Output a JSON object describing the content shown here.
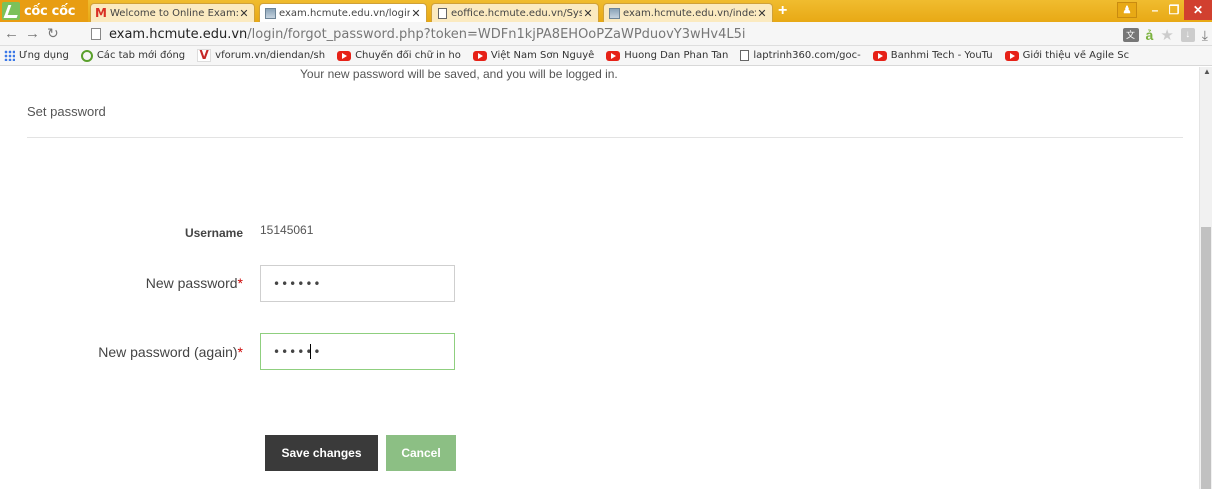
{
  "browser": {
    "brand": "cốc cốc",
    "tabs": [
      {
        "label": "Welcome to Online Exam:",
        "icon": "gmail-icon",
        "active": false
      },
      {
        "label": "exam.hcmute.edu.vn/login",
        "icon": "site-icon",
        "active": true
      },
      {
        "label": "eoffice.hcmute.edu.vn/Syst",
        "icon": "page-icon",
        "active": false
      },
      {
        "label": "exam.hcmute.edu.vn/index",
        "icon": "site-icon",
        "active": false
      }
    ],
    "new_tab": "+",
    "url_host": "exam.hcmute.edu.vn",
    "url_path": "/login/forgot_password.php?token=WDFn1kjPA8EHOoPZaWPduovY3wHv4L5i",
    "bookmarks": [
      {
        "label": "Ứng dụng",
        "icon": "apps-grid-icon"
      },
      {
        "label": "Các tab mới đóng",
        "icon": "recent-tabs-icon"
      },
      {
        "label": "vforum.vn/diendan/sh",
        "icon": "vforum-icon"
      },
      {
        "label": "Chuyển đổi chữ in ho",
        "icon": "youtube-icon"
      },
      {
        "label": "Việt Nam Sơn Nguyễ",
        "icon": "youtube-icon"
      },
      {
        "label": "Huong Dan Phan Tan",
        "icon": "youtube-icon"
      },
      {
        "label": "laptrinh360.com/goc-",
        "icon": "page-icon"
      },
      {
        "label": "Banhmi Tech - YouTu",
        "icon": "youtube-icon"
      },
      {
        "label": "Giới thiệu về Agile Sc",
        "icon": "youtube-icon"
      }
    ]
  },
  "page": {
    "info_text": "Your new password will be saved, and you will be logged in.",
    "section_title": "Set password",
    "username_label": "Username",
    "username_value": "15145061",
    "new_password_label": "New password",
    "new_password_value": "••••••",
    "new_password_again_label": "New password (again)",
    "new_password_again_value": "••••••",
    "required_mark": "*",
    "save_label": "Save changes",
    "cancel_label": "Cancel"
  },
  "colors": {
    "tabstrip": "#e8a915",
    "save_button": "#3a3a3a",
    "cancel_button": "#8cbf84",
    "required": "#cc0000",
    "focus_border": "#8fcf7f"
  }
}
